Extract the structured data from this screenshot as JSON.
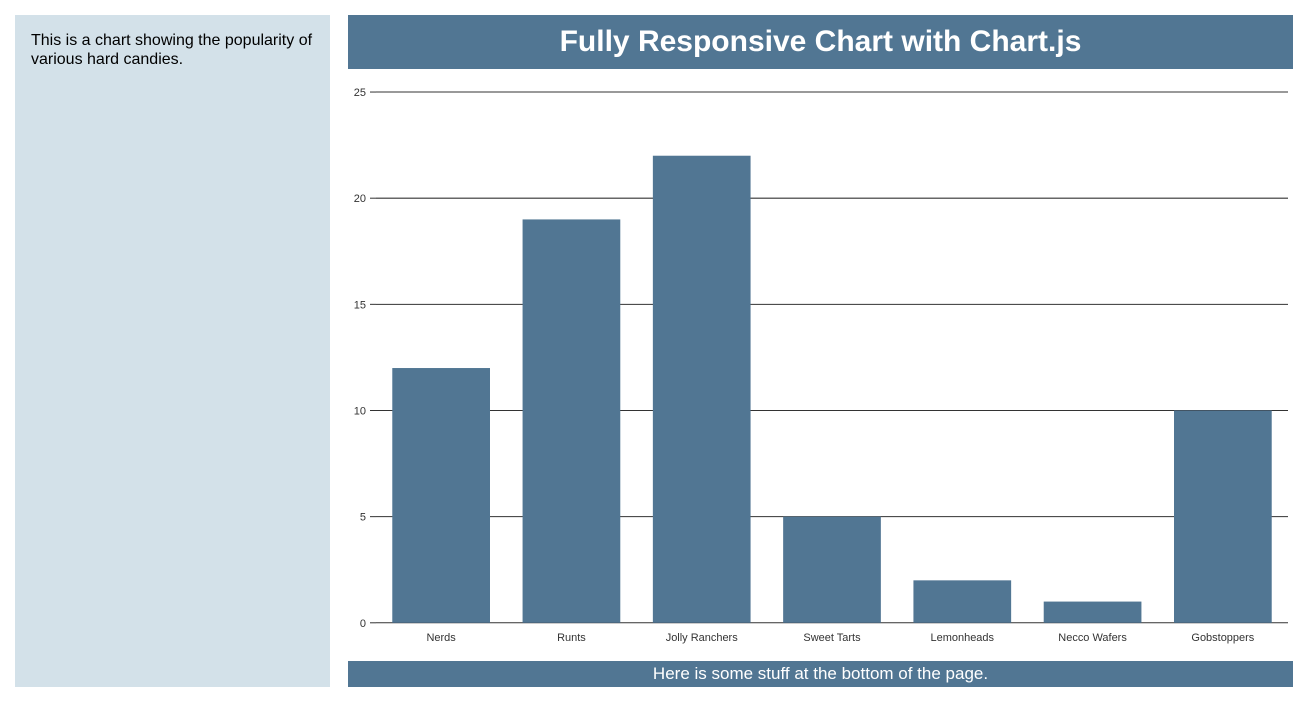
{
  "sidebar": {
    "description": "This is a chart showing the popularity of various hard candies."
  },
  "header": {
    "title": "Fully Responsive Chart with Chart.js"
  },
  "footer": {
    "text": "Here is some stuff at the bottom of the page."
  },
  "chart_data": {
    "type": "bar",
    "categories": [
      "Nerds",
      "Runts",
      "Jolly Ranchers",
      "Sweet Tarts",
      "Lemonheads",
      "Necco Wafers",
      "Gobstoppers"
    ],
    "values": [
      12,
      19,
      22,
      5,
      2,
      1,
      10
    ],
    "title": "",
    "xlabel": "",
    "ylabel": "",
    "ylim": [
      0,
      25
    ],
    "yticks": [
      0,
      5,
      10,
      15,
      20,
      25
    ],
    "bar_color": "#517693"
  }
}
